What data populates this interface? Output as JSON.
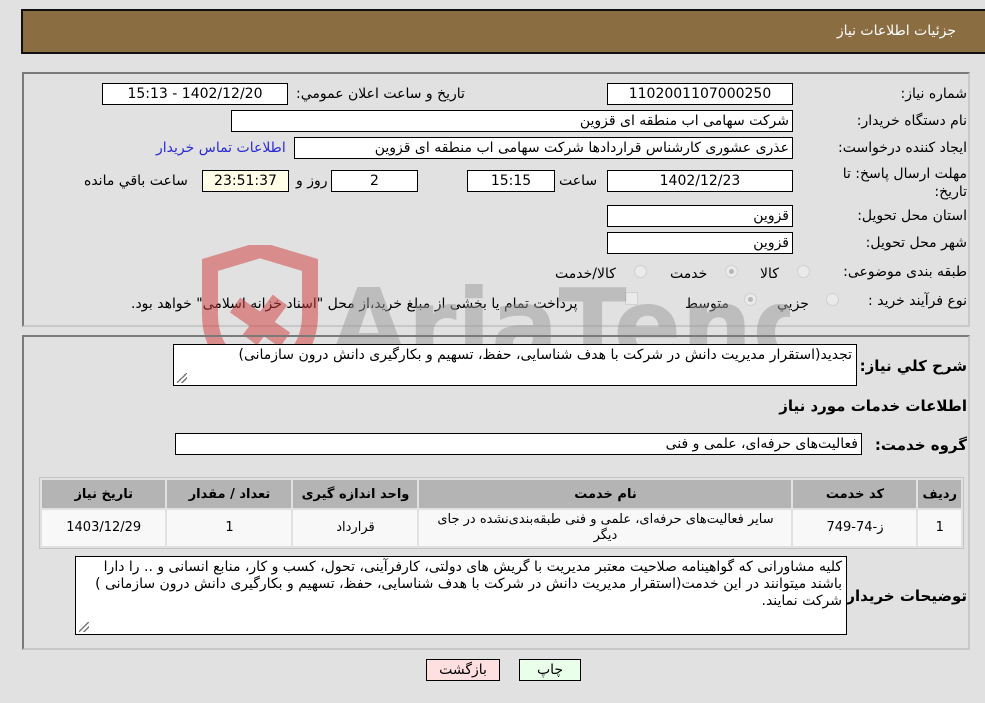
{
  "header": {
    "title": "جزئیات اطلاعات نیاز"
  },
  "fields": {
    "need_number": {
      "label": "شماره نیاز:",
      "value": "1102001107000250"
    },
    "announce_datetime": {
      "label": "تاریخ و ساعت اعلان عمومي:",
      "value": "1402/12/20 - 15:13"
    },
    "buyer_org": {
      "label": "نام دستگاه خریدار:",
      "value": "شرکت سهامی اب منطقه ای قزوین"
    },
    "creator": {
      "label": "ایجاد کننده درخواست:",
      "value": "عذری عشوری کارشناس قراردادها شرکت سهامی اب منطقه ای قزوین"
    },
    "buyer_contact_link": "اطلاعات تماس خریدار",
    "deadline": {
      "label": "مهلت ارسال پاسخ: تا تاریخ:",
      "date": "1402/12/23",
      "time_label": "ساعت",
      "time": "15:15",
      "days": "2",
      "days_label": "روز و",
      "remaining": "23:51:37",
      "remaining_label": "ساعت باقي مانده"
    },
    "province": {
      "label": "استان محل تحویل:",
      "value": "قزوین"
    },
    "city": {
      "label": "شهر محل تحویل:",
      "value": "قزوین"
    },
    "category": {
      "label": "طبقه بندی موضوعی:",
      "options": [
        {
          "label": "کالا",
          "selected": false
        },
        {
          "label": "خدمت",
          "selected": true
        },
        {
          "label": "کالا/خدمت",
          "selected": false
        }
      ]
    },
    "purchase_type": {
      "label": "نوع فرآیند خرید :",
      "options": [
        {
          "label": "جزيي",
          "selected": false
        },
        {
          "label": "متوسط",
          "selected": true
        }
      ],
      "treasury_note": "پرداخت تمام یا بخشی از مبلغ خرید،از محل \"اسناد خزانه اسلامی\" خواهد بود.",
      "treasury_checked": false
    }
  },
  "description": {
    "label": "شرح کلي نیاز:",
    "value": "تجدید(استقرار مدیریت دانش در شرکت با هدف شناسایی، حفظ، تسهیم و بکارگیری دانش درون سازمانی)"
  },
  "services_section": {
    "title": "اطلاعات خدمات مورد نیاز",
    "group_label": "گروه خدمت:",
    "group_value": "فعالیت‌های حرفه‌ای، علمی و فنی",
    "table": {
      "headers": [
        "ردیف",
        "کد خدمت",
        "نام خدمت",
        "واحد اندازه گیری",
        "تعداد / مقدار",
        "تاریخ نیاز"
      ],
      "rows": [
        [
          "1",
          "ز-74-749",
          "سایر فعالیت‌های حرفه‌ای، علمی و فنی طبقه‌بندی‌نشده در جای دیگر",
          "قرارداد",
          "1",
          "1403/12/29"
        ]
      ]
    }
  },
  "buyer_notes": {
    "label": "توضیحات خریدار:",
    "value": "کلیه مشاورانی که گواهینامه صلاحیت معتبر مدیریت با گریش های دولتی، کارفرآینی، تحول، کسب و کار، منابع انسانی و .. را دارا باشند میتوانند در این خدمت(استقرار مدیریت دانش در شرکت با هدف شناسایی، حفظ، تسهیم و بکارگیری دانش درون سازمانی ) شرکت نمایند."
  },
  "buttons": {
    "print": "چاپ",
    "back": "بازگشت"
  },
  "watermark": {
    "text": "AriaTender.neT"
  },
  "colors": {
    "header_bg": "#8b6d42",
    "link": "#2a2ad6",
    "print_bg": "#eaffea",
    "back_bg": "#ffe0e0",
    "remaining_bg": "#ffffe8"
  }
}
